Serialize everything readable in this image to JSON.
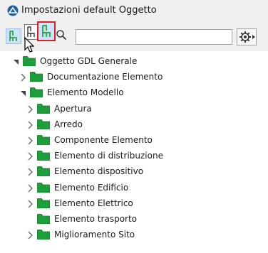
{
  "window": {
    "title": "Impostazioni default Oggetto"
  },
  "toolbar": {
    "search_value": "",
    "search_placeholder": ""
  },
  "colors": {
    "folder": "#1e9e3a",
    "folder_dark": "#167a2c",
    "accent": "#e02020",
    "selected": "#cce4f7"
  },
  "tree": {
    "root": {
      "label": "Oggetto GDL Generale",
      "expanded": true
    },
    "items": [
      {
        "label": "Documentazione Elemento",
        "level": 1,
        "expanded": false,
        "has_children": true
      },
      {
        "label": "Elemento Modello",
        "level": 1,
        "expanded": true,
        "has_children": true
      },
      {
        "label": "Apertura",
        "level": 2,
        "expanded": false,
        "has_children": true
      },
      {
        "label": "Arredo",
        "level": 2,
        "expanded": false,
        "has_children": true
      },
      {
        "label": "Componente Elemento",
        "level": 2,
        "expanded": false,
        "has_children": true
      },
      {
        "label": "Elemento di distribuzione",
        "level": 2,
        "expanded": false,
        "has_children": true
      },
      {
        "label": "Elemento dispositivo",
        "level": 2,
        "expanded": false,
        "has_children": true
      },
      {
        "label": "Elemento Edificio",
        "level": 2,
        "expanded": false,
        "has_children": true
      },
      {
        "label": "Elemento Elettrico",
        "level": 2,
        "expanded": false,
        "has_children": true
      },
      {
        "label": "Elemento trasporto",
        "level": 2,
        "expanded": false,
        "has_children": false
      },
      {
        "label": "Miglioramento Sito",
        "level": 2,
        "expanded": false,
        "has_children": true
      }
    ]
  }
}
